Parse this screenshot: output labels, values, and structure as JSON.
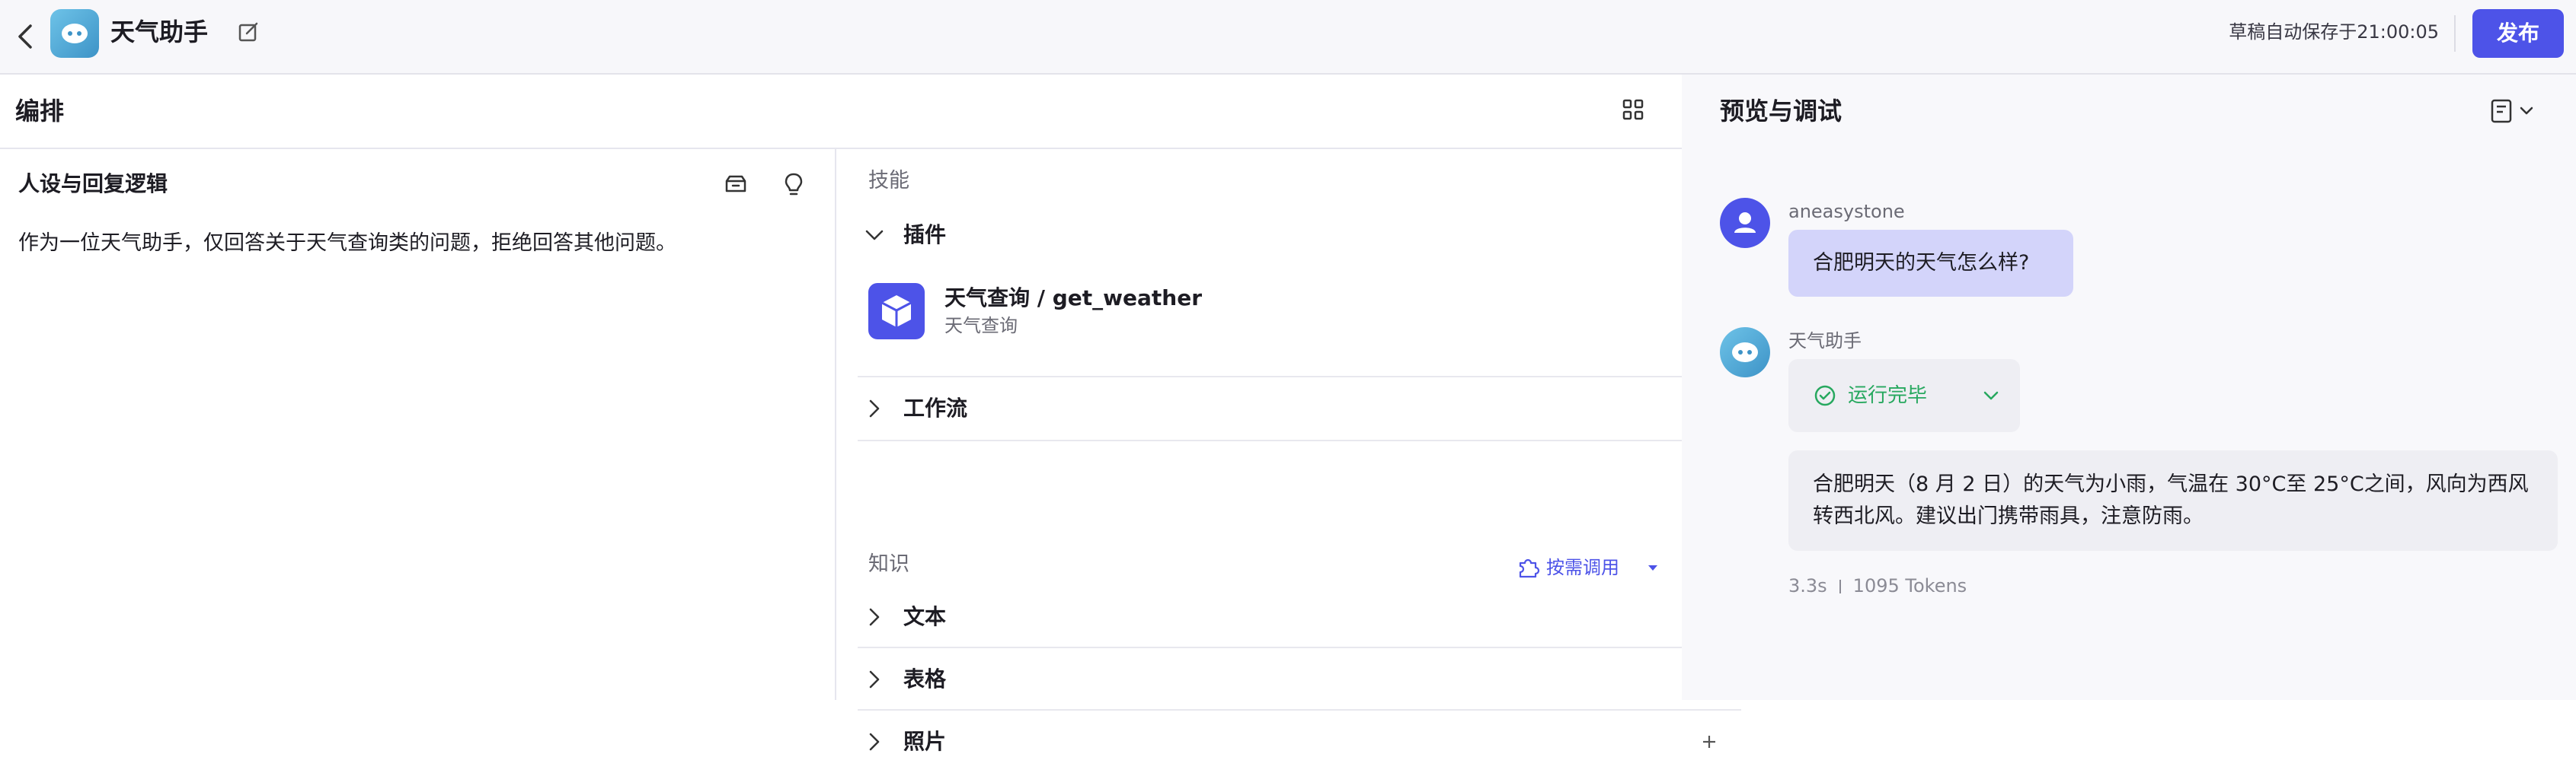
{
  "header": {
    "app_name": "天气助手",
    "save_status": "草稿自动保存于21:00:05",
    "publish_label": "发布"
  },
  "arrange": {
    "title": "编排"
  },
  "persona": {
    "title": "人设与回复逻辑",
    "text": "作为一位天气助手，仅回答关于天气查询类的问题，拒绝回答其他问题。"
  },
  "skills": {
    "section_label": "技能",
    "plugins_label": "插件",
    "plugin": {
      "name": "天气查询 / get_weather",
      "desc": "天气查询"
    },
    "workflow_label": "工作流"
  },
  "knowledge": {
    "section_label": "知识",
    "on_demand_label": "按需调用",
    "items": [
      "文本",
      "表格",
      "照片"
    ]
  },
  "preview": {
    "title": "预览与调试",
    "user_name": "aneasystone",
    "user_message": "合肥明天的天气怎么样?",
    "bot_name": "天气助手",
    "run_status": "运行完毕",
    "bot_reply": "合肥明天（8 月 2 日）的天气为小雨，气温在 30°C至 25°C之间，风向为西风转西北风。建议出门携带雨具，注意防雨。",
    "duration": "3.3s",
    "tokens": "1095 Tokens"
  },
  "colors": {
    "accent": "#4d53e8",
    "success": "#27a85f",
    "user_bubble": "#d3d4fa",
    "bot_bubble": "#eeeef3"
  }
}
